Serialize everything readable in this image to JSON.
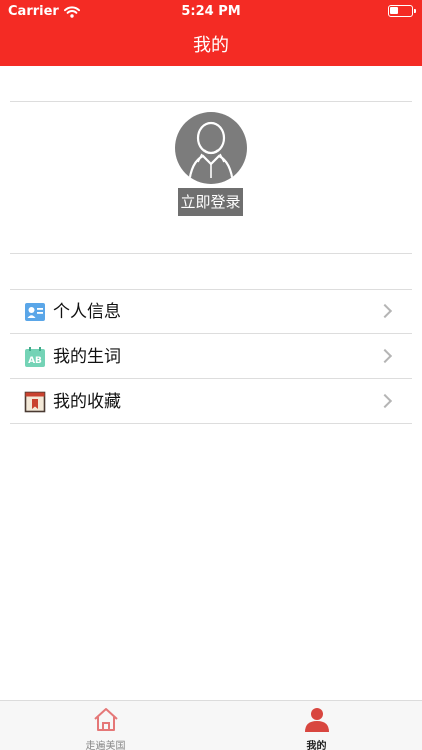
{
  "status_bar": {
    "carrier": "Carrier",
    "time": "5:24 PM",
    "battery_level": 0.3
  },
  "header": {
    "title": "我的"
  },
  "profile": {
    "login_label": "立即登录",
    "avatar_icon": "user-avatar-icon"
  },
  "menu": {
    "items": [
      {
        "label": "个人信息",
        "icon": "id-card-icon"
      },
      {
        "label": "我的生词",
        "icon": "calendar-ab-icon"
      },
      {
        "label": "我的收藏",
        "icon": "bookmark-icon"
      }
    ]
  },
  "tabbar": {
    "tabs": [
      {
        "label": "走遍美国",
        "icon": "home-icon",
        "selected": false
      },
      {
        "label": "我的",
        "icon": "person-icon",
        "selected": true
      }
    ]
  },
  "colors": {
    "brand": "#f42b24",
    "tab_selected": "#d8463f",
    "divider": "#dddddd"
  }
}
